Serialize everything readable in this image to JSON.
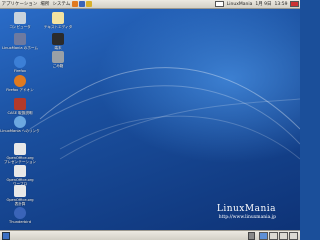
{
  "top_panel": {
    "menus": [
      {
        "label": "アプリケーション"
      },
      {
        "label": "場所"
      },
      {
        "label": "システム"
      }
    ],
    "launchers": [
      "firefox-icon",
      "mail-icon",
      "help-icon"
    ],
    "status_text": "LinuxMania",
    "date": "1月 9日",
    "time": "13:59"
  },
  "desktop_icons": [
    {
      "label": "コンピュータ",
      "icon": "computer-icon",
      "color": "#c9d3dc"
    },
    {
      "label": "LinuxMania のホーム",
      "icon": "home-icon",
      "color": "#6e7aa0"
    },
    {
      "label": "Firefox",
      "icon": "globe-icon",
      "color": "#3c7fd6"
    },
    {
      "label": "Firefox アドオン",
      "icon": "firefox-icon",
      "color": "#e07a1f"
    },
    {
      "label": "CASE 取扱説明",
      "icon": "document-icon",
      "color": "#b23a2a"
    },
    {
      "label": "LinuxMania へのリンク",
      "icon": "link-icon",
      "color": "#6ca8e0"
    },
    {
      "label": "OpenOffice.org\nプレゼンテーション",
      "icon": "presentation-icon",
      "color": "#e8e8e8"
    },
    {
      "label": "OpenOffice.org\nワープロ",
      "icon": "writer-icon",
      "color": "#e8e8e8"
    },
    {
      "label": "OpenOffice.org\n表計算",
      "icon": "spreadsheet-icon",
      "color": "#e8e8e8"
    },
    {
      "label": "Thunderbird",
      "icon": "thunderbird-icon",
      "color": "#3a64b8"
    },
    {
      "label": "テキストエディタ",
      "icon": "text-editor-icon",
      "color": "#f2e2a0"
    },
    {
      "label": "端末",
      "icon": "terminal-icon",
      "color": "#2b2b2b"
    },
    {
      "label": "ごみ箱",
      "icon": "trash-icon",
      "color": "#9aa0a6"
    }
  ],
  "branding": {
    "name": "LinuxMania",
    "url": "http://www.linuxmania.jp"
  },
  "bottom_panel": {
    "workspaces": [
      "1",
      "2",
      "3",
      "4"
    ]
  }
}
